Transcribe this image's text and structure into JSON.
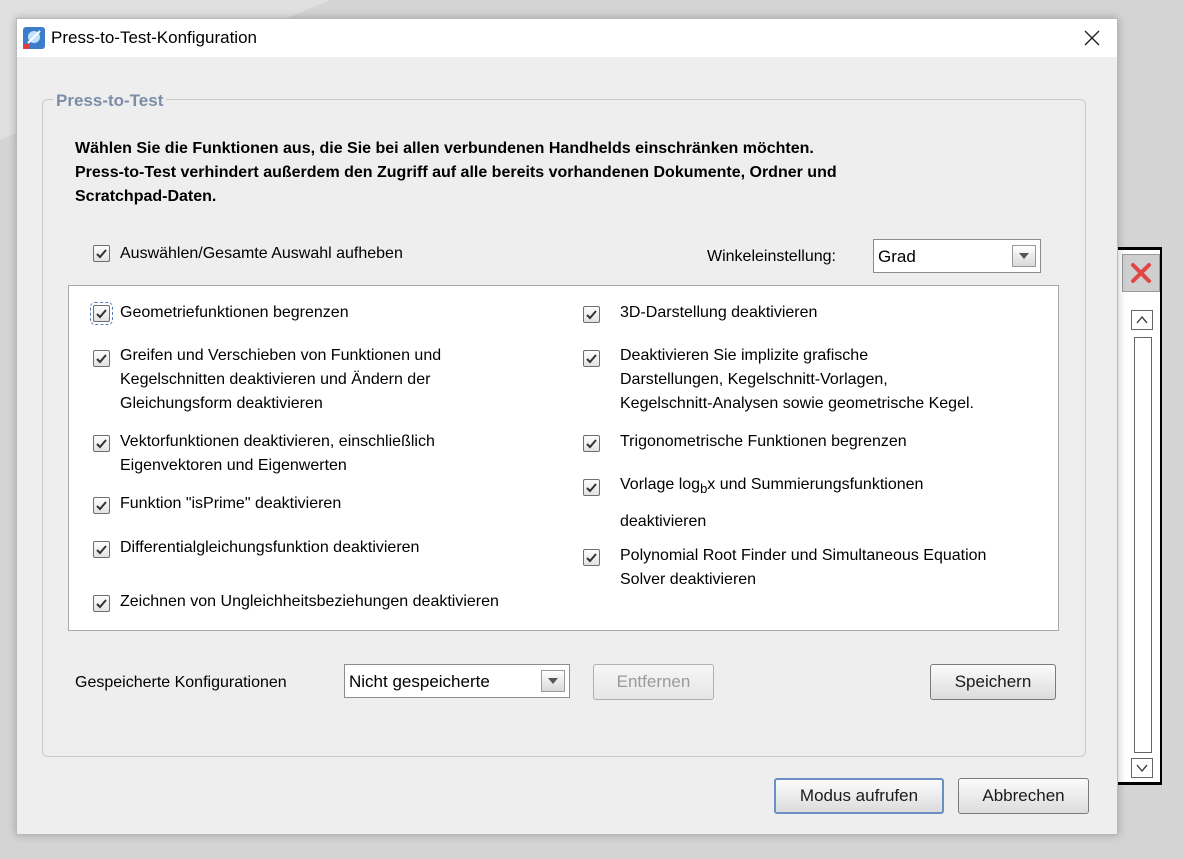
{
  "window": {
    "title": "Press-to-Test-Konfiguration"
  },
  "group": {
    "title": "Press-to-Test"
  },
  "intro": [
    "Wählen Sie die Funktionen aus, die Sie bei allen verbundenen Handhelds einschränken möchten.",
    "Press-to-Test verhindert außerdem den Zugriff auf alle bereits vorhandenen Dokumente, Ordner und",
    "Scratchpad-Daten."
  ],
  "select_all": {
    "label": "Auswählen/Gesamte Auswahl aufheben",
    "checked": true
  },
  "angle": {
    "label": "Winkeleinstellung:",
    "value": "Grad"
  },
  "options_left": [
    {
      "lines": [
        "Geometriefunktionen begrenzen"
      ],
      "checked": true
    },
    {
      "lines": [
        "Greifen und Verschieben von Funktionen und",
        "Kegelschnitten deaktivieren und Ändern der",
        "Gleichungsform deaktivieren"
      ],
      "checked": true
    },
    {
      "lines": [
        "Vektorfunktionen deaktivieren, einschließlich",
        "Eigenvektoren und Eigenwerten"
      ],
      "checked": true
    },
    {
      "lines": [
        "Funktion \"isPrime\" deaktivieren"
      ],
      "checked": true
    },
    {
      "lines": [
        "Differentialgleichungsfunktion deaktivieren"
      ],
      "checked": true
    },
    {
      "lines": [
        "Zeichnen von Ungleichheitsbeziehungen deaktivieren"
      ],
      "checked": true
    }
  ],
  "options_right": [
    {
      "lines": [
        "3D-Darstellung deaktivieren"
      ],
      "checked": true
    },
    {
      "lines": [
        "Deaktivieren Sie implizite grafische",
        "Darstellungen, Kegelschnitt-Vorlagen,",
        "Kegelschnitt-Analysen sowie geometrische Kegel."
      ],
      "checked": true
    },
    {
      "lines": [
        "Trigonometrische Funktionen begrenzen"
      ],
      "checked": true
    },
    {
      "log_prefix": "Vorlage log",
      "log_sub": "b",
      "log_suffix": "x und Summierungsfunktionen",
      "line2": "deaktivieren",
      "checked": true
    },
    {
      "lines": [
        "Polynomial Root Finder und Simultaneous Equation",
        "Solver deaktivieren"
      ],
      "checked": true
    }
  ],
  "saved_configs": {
    "label": "Gespeicherte Konfigurationen",
    "value": "Nicht gespeicherte"
  },
  "buttons": {
    "remove": "Entfernen",
    "save": "Speichern",
    "enter_mode": "Modus aufrufen",
    "cancel": "Abbrechen"
  },
  "icons": {
    "app": "press-to-test-app-icon",
    "close": "close-icon",
    "check": "checkmark-icon",
    "dropdown": "chevron-down-icon",
    "side_close": "red-x-icon",
    "scroll_up": "scroll-up-arrow-icon",
    "scroll_down": "scroll-down-arrow-icon"
  },
  "colors": {
    "group_title": "#7b8da7",
    "side_close": "#e04646",
    "default_button_border": "#6b8fc4"
  }
}
